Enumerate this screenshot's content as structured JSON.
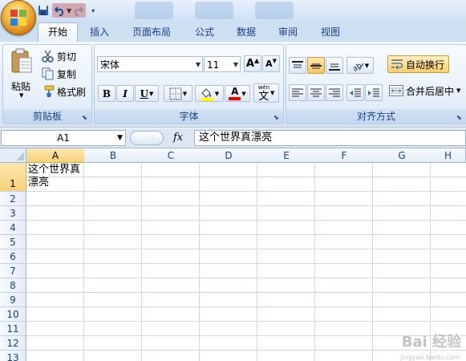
{
  "quick_access": {
    "icons": [
      "office-logo",
      "save-icon",
      "undo-icon",
      "redo-icon",
      "customize-dropdown"
    ]
  },
  "tabs": [
    {
      "label": "开始",
      "active": true
    },
    {
      "label": "插入",
      "active": false
    },
    {
      "label": "页面布局",
      "active": false
    },
    {
      "label": "公式",
      "active": false
    },
    {
      "label": "数据",
      "active": false
    },
    {
      "label": "审阅",
      "active": false
    },
    {
      "label": "视图",
      "active": false
    }
  ],
  "ribbon": {
    "clipboard": {
      "label": "剪贴板",
      "paste": "粘贴",
      "cut": "剪切",
      "copy": "复制",
      "format_painter": "格式刷"
    },
    "font": {
      "label": "字体",
      "font_name": "宋体",
      "font_size": "11",
      "bold": "B",
      "italic": "I",
      "underline": "U",
      "font_color_glyph": "A",
      "phonetic_glyph": "文",
      "phonetic_top": "wén",
      "grow_glyph": "A",
      "shrink_glyph": "A",
      "fill_color": "#ffff00",
      "font_color": "#ff0000"
    },
    "alignment": {
      "label": "对齐方式",
      "wrap_text": "自动换行",
      "merge_center": "合并后居中"
    }
  },
  "formula_bar": {
    "name_box": "A1",
    "fx": "fx",
    "value": "这个世界真漂亮"
  },
  "sheet": {
    "columns": [
      "A",
      "B",
      "C",
      "D",
      "E",
      "F",
      "G",
      "H"
    ],
    "rows": [
      "1",
      "2",
      "3",
      "4",
      "5",
      "6",
      "7",
      "8",
      "9",
      "10",
      "11",
      "12",
      "13"
    ],
    "selected_cell": "A1",
    "cell_a1": "这个世界真漂亮"
  },
  "watermark": {
    "brand": "Bai 经验",
    "url": "jingyan.baidu.com"
  },
  "colors": {
    "accent": "#15428b",
    "ribbon_bg": "#dfe9f5",
    "selected_header": "#f9d27a",
    "wrap_active": "#f9cf6c"
  }
}
